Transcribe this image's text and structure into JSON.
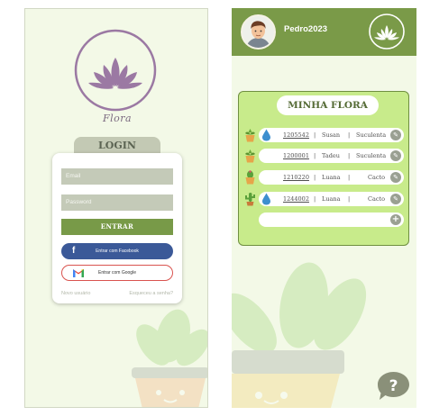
{
  "login_screen": {
    "brand_name": "Flora",
    "tab_label": "LOGIN",
    "email_placeholder": "Email",
    "password_placeholder": "Password",
    "enter_button": "ENTRAR",
    "facebook_button": "Entrar com Facebook",
    "google_button": "Entrar com Google",
    "new_user_link": "Novo usuário",
    "forgot_password_link": "Esqueceu a senha?"
  },
  "home_screen": {
    "username": "Pedro2023",
    "panel_title": "MINHA FLORA",
    "plants": [
      {
        "id": "1205542",
        "owner": "Susan",
        "type": "Suculenta",
        "sep": "|",
        "icon": "potted-plant-icon",
        "has_drop": true
      },
      {
        "id": "1200001",
        "owner": "Tadeu",
        "type": "Suculenta",
        "sep": "|",
        "icon": "potted-plant-icon",
        "has_drop": false
      },
      {
        "id": "1210220",
        "owner": "Luana",
        "type": "Cacto",
        "sep": "|",
        "icon": "cactus-pot-icon",
        "has_drop": false
      },
      {
        "id": "1244002",
        "owner": "Luana",
        "type": "Cacto",
        "sep": "|",
        "icon": "cactus-icon",
        "has_drop": true
      }
    ],
    "help_icon": "question-bubble-icon"
  },
  "colors": {
    "header_green": "#7a9a48",
    "panel_green": "#c8eb8b",
    "lotus_purple": "#9b79a3",
    "background": "#f3f9e7"
  }
}
